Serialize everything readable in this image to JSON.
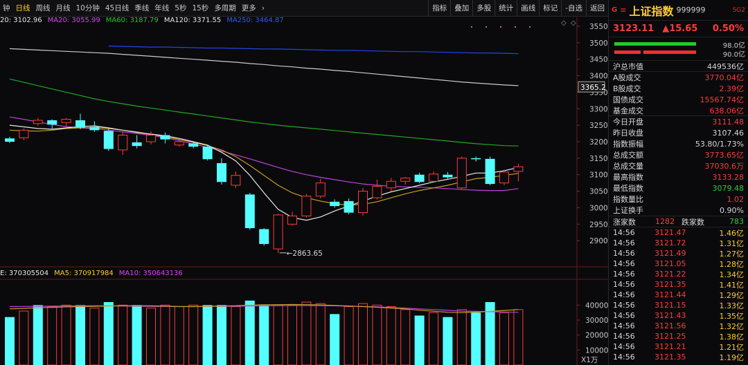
{
  "toolbar": {
    "left_items": [
      "钟",
      "日线",
      "周线",
      "月线",
      "10分钟",
      "45日线",
      "季线",
      "年线",
      "5秒",
      "15秒",
      "多周期",
      "更多"
    ],
    "active_index": 1,
    "more_arrow": "›",
    "right_items": [
      "指标",
      "叠加",
      "多股",
      "统计",
      "画线",
      "标记",
      "-自选",
      "返回"
    ]
  },
  "ma_legend": [
    {
      "label": "20: 3102.96",
      "color": "#e8e8e8"
    },
    {
      "label": "MA20: 3055.99",
      "color": "#e040fb"
    },
    {
      "label": "MA60: 3187.79",
      "color": "#22cc22"
    },
    {
      "label": "MA120: 3371.55",
      "color": "#e8e8e8"
    },
    {
      "label": "MA250: 3464.87",
      "color": "#3355ff"
    }
  ],
  "vol_legend": [
    {
      "label": "E: 370305504",
      "color": "#e8e8e8"
    },
    {
      "label": "MA5: 370917984",
      "color": "#ffcc33"
    },
    {
      "label": "MA10: 350643136",
      "color": "#e040fb"
    }
  ],
  "chart_data": {
    "type": "candlestick",
    "price_axis": {
      "min": 2850,
      "max": 3550,
      "ticks": [
        3550,
        3500,
        3450,
        3400,
        3350,
        3300,
        3250,
        3200,
        3150,
        3100,
        3050,
        3000,
        2950,
        2900
      ]
    },
    "price_marker": "3365.2",
    "low_annotation": "2863.65",
    "volume_axis": {
      "max": 48000,
      "ticks": [
        40000,
        30000,
        20000,
        10000
      ],
      "unit_label": "X1万"
    },
    "candles": [
      {
        "o": 3210,
        "c": 3200,
        "h": 3215,
        "l": 3196
      },
      {
        "o": 3212,
        "c": 3235,
        "h": 3240,
        "l": 3205
      },
      {
        "o": 3255,
        "c": 3265,
        "h": 3272,
        "l": 3248
      },
      {
        "o": 3265,
        "c": 3252,
        "h": 3268,
        "l": 3240
      },
      {
        "o": 3258,
        "c": 3268,
        "h": 3272,
        "l": 3245
      },
      {
        "o": 3265,
        "c": 3243,
        "h": 3285,
        "l": 3238
      },
      {
        "o": 3245,
        "c": 3235,
        "h": 3262,
        "l": 3230
      },
      {
        "o": 3233,
        "c": 3178,
        "h": 3240,
        "l": 3172
      },
      {
        "o": 3175,
        "c": 3220,
        "h": 3230,
        "l": 3160
      },
      {
        "o": 3198,
        "c": 3187,
        "h": 3220,
        "l": 3180
      },
      {
        "o": 3200,
        "c": 3220,
        "h": 3232,
        "l": 3192
      },
      {
        "o": 3220,
        "c": 3207,
        "h": 3228,
        "l": 3195
      },
      {
        "o": 3190,
        "c": 3200,
        "h": 3205,
        "l": 3185
      },
      {
        "o": 3195,
        "c": 3185,
        "h": 3200,
        "l": 3180
      },
      {
        "o": 3185,
        "c": 3147,
        "h": 3190,
        "l": 3143
      },
      {
        "o": 3135,
        "c": 3078,
        "h": 3150,
        "l": 3070
      },
      {
        "o": 3068,
        "c": 3098,
        "h": 3110,
        "l": 3060
      },
      {
        "o": 3040,
        "c": 2938,
        "h": 3045,
        "l": 2933
      },
      {
        "o": 2935,
        "c": 2890,
        "h": 2938,
        "l": 2885
      },
      {
        "o": 2875,
        "c": 2978,
        "h": 2982,
        "l": 2863
      },
      {
        "o": 2950,
        "c": 2975,
        "h": 2988,
        "l": 2945
      },
      {
        "o": 2975,
        "c": 3035,
        "h": 3042,
        "l": 2970
      },
      {
        "o": 3035,
        "c": 3075,
        "h": 3088,
        "l": 3028
      },
      {
        "o": 3018,
        "c": 3005,
        "h": 3025,
        "l": 3000
      },
      {
        "o": 3020,
        "c": 2985,
        "h": 3028,
        "l": 2980
      },
      {
        "o": 2985,
        "c": 3050,
        "h": 3060,
        "l": 2975
      },
      {
        "o": 3030,
        "c": 3065,
        "h": 3085,
        "l": 3025
      },
      {
        "o": 3060,
        "c": 3080,
        "h": 3090,
        "l": 3050
      },
      {
        "o": 3080,
        "c": 3090,
        "h": 3093,
        "l": 3070
      },
      {
        "o": 3100,
        "c": 3078,
        "h": 3106,
        "l": 3074
      },
      {
        "o": 3080,
        "c": 3102,
        "h": 3110,
        "l": 3078
      },
      {
        "o": 3100,
        "c": 3092,
        "h": 3108,
        "l": 3088
      },
      {
        "o": 3060,
        "c": 3150,
        "h": 3155,
        "l": 3055
      },
      {
        "o": 3150,
        "c": 3148,
        "h": 3155,
        "l": 3140
      },
      {
        "o": 3148,
        "c": 3072,
        "h": 3155,
        "l": 3068
      },
      {
        "o": 3075,
        "c": 3108,
        "h": 3115,
        "l": 3068
      },
      {
        "o": 3110,
        "c": 3124,
        "h": 3133,
        "l": 3080
      }
    ],
    "volumes": [
      {
        "v": 32000,
        "dir": "down"
      },
      {
        "v": 36000,
        "dir": "up"
      },
      {
        "v": 40000,
        "dir": "down"
      },
      {
        "v": 39000,
        "dir": "up"
      },
      {
        "v": 40000,
        "dir": "up"
      },
      {
        "v": 40000,
        "dir": "down"
      },
      {
        "v": 38000,
        "dir": "up"
      },
      {
        "v": 42000,
        "dir": "down"
      },
      {
        "v": 40000,
        "dir": "up"
      },
      {
        "v": 40000,
        "dir": "down"
      },
      {
        "v": 38000,
        "dir": "up"
      },
      {
        "v": 40000,
        "dir": "up"
      },
      {
        "v": 39000,
        "dir": "up"
      },
      {
        "v": 40000,
        "dir": "up"
      },
      {
        "v": 40000,
        "dir": "down"
      },
      {
        "v": 40000,
        "dir": "down"
      },
      {
        "v": 39000,
        "dir": "up"
      },
      {
        "v": 43000,
        "dir": "down"
      },
      {
        "v": 40000,
        "dir": "down"
      },
      {
        "v": 40000,
        "dir": "up"
      },
      {
        "v": 40000,
        "dir": "up"
      },
      {
        "v": 42000,
        "dir": "up"
      },
      {
        "v": 41000,
        "dir": "up"
      },
      {
        "v": 34000,
        "dir": "down"
      },
      {
        "v": 39000,
        "dir": "up"
      },
      {
        "v": 41000,
        "dir": "up"
      },
      {
        "v": 40000,
        "dir": "up"
      },
      {
        "v": 39000,
        "dir": "up"
      },
      {
        "v": 37000,
        "dir": "up"
      },
      {
        "v": 33000,
        "dir": "down"
      },
      {
        "v": 35000,
        "dir": "up"
      },
      {
        "v": 32000,
        "dir": "down"
      },
      {
        "v": 37000,
        "dir": "up"
      },
      {
        "v": 35000,
        "dir": "down"
      },
      {
        "v": 42000,
        "dir": "down"
      },
      {
        "v": 35000,
        "dir": "up"
      },
      {
        "v": 37000,
        "dir": "up"
      }
    ],
    "lines": {
      "ma10": {
        "color": "#e8e8e8",
        "values": [
          3250,
          3245,
          3240,
          3238,
          3242,
          3246,
          3248,
          3242,
          3235,
          3228,
          3223,
          3218,
          3210,
          3200,
          3190,
          3168,
          3142,
          3098,
          3045,
          2995,
          2970,
          2962,
          2972,
          2990,
          3005,
          3020,
          3035,
          3048,
          3058,
          3068,
          3078,
          3086,
          3095,
          3105,
          3105,
          3112,
          3122
        ]
      },
      "ma20": {
        "color": "#c8a020",
        "values": [
          3235,
          3233,
          3232,
          3235,
          3240,
          3242,
          3243,
          3240,
          3235,
          3230,
          3222,
          3215,
          3207,
          3198,
          3188,
          3175,
          3155,
          3128,
          3098,
          3068,
          3045,
          3030,
          3020,
          3012,
          3008,
          3010,
          3018,
          3030,
          3042,
          3052,
          3060,
          3068,
          3078,
          3088,
          3092,
          3098,
          3104
        ]
      },
      "ma30": {
        "color": "#c040e0",
        "values": [
          3275,
          3268,
          3260,
          3252,
          3246,
          3242,
          3240,
          3235,
          3230,
          3225,
          3220,
          3212,
          3203,
          3193,
          3183,
          3172,
          3160,
          3148,
          3135,
          3122,
          3110,
          3100,
          3092,
          3085,
          3078,
          3072,
          3068,
          3065,
          3063,
          3062,
          3060,
          3058,
          3055,
          3053,
          3052,
          3052,
          3058
        ]
      },
      "ma60": {
        "color": "#22aa22",
        "values": [
          3390,
          3380,
          3370,
          3360,
          3350,
          3340,
          3330,
          3322,
          3315,
          3308,
          3302,
          3296,
          3290,
          3284,
          3278,
          3272,
          3266,
          3260,
          3255,
          3250,
          3246,
          3242,
          3238,
          3234,
          3230,
          3226,
          3222,
          3218,
          3214,
          3210,
          3206,
          3202,
          3198,
          3194,
          3191,
          3188,
          3187
        ]
      },
      "ma120": {
        "color": "#cccccc",
        "values": [
          3482,
          3480,
          3478,
          3476,
          3474,
          3472,
          3470,
          3468,
          3465,
          3462,
          3459,
          3456,
          3453,
          3450,
          3447,
          3444,
          3441,
          3437,
          3434,
          3430,
          3427,
          3423,
          3420,
          3416,
          3413,
          3409,
          3405,
          3401,
          3397,
          3393,
          3389,
          3385,
          3381,
          3378,
          3375,
          3372,
          3370
        ]
      },
      "ma250": {
        "color": "#2244ee",
        "start_index": 7,
        "values": [
          3490,
          3489,
          3488,
          3487,
          3487,
          3486,
          3485,
          3484,
          3484,
          3483,
          3482,
          3481,
          3481,
          3480,
          3479,
          3478,
          3477,
          3477,
          3476,
          3475,
          3474,
          3473,
          3473,
          3472,
          3471,
          3470,
          3469,
          3469,
          3468,
          3467
        ]
      }
    },
    "vol_lines": {
      "vma5": {
        "color": "#c8a020",
        "values": [
          37500,
          37800,
          38200,
          38500,
          38800,
          39000,
          39200,
          39400,
          39500,
          39600,
          39500,
          39300,
          39100,
          39000,
          39200,
          39400,
          39600,
          40000,
          40200,
          40300,
          40400,
          40300,
          40100,
          39800,
          39400,
          39000,
          38600,
          38000,
          37500,
          36600,
          35900,
          35200,
          35000,
          35300,
          35800,
          36400,
          37000
        ]
      },
      "vma10": {
        "color": "#c040e0",
        "values": [
          39000,
          39100,
          39200,
          39300,
          39400,
          39500,
          39500,
          39500,
          39400,
          39300,
          39200,
          39100,
          39000,
          39000,
          39100,
          39200,
          39300,
          39400,
          39500,
          39600,
          39700,
          39700,
          39600,
          39500,
          39300,
          39100,
          38800,
          38400,
          38000,
          37500,
          37000,
          36500,
          36000,
          35800,
          35600,
          35400,
          35200
        ]
      }
    }
  },
  "panel": {
    "g_label": "G",
    "eq_label": "≡",
    "name": "上证指数",
    "code": "999999",
    "badge": "SG2",
    "price": "3123.11",
    "change": "▲15.65",
    "pct": "0.50%",
    "bar_labels": [
      "98.0亿",
      "90.0亿"
    ],
    "rows": [
      {
        "label": "沪总市值",
        "value": "449536亿",
        "cls": "white",
        "sep": true
      },
      {
        "label": "A股成交",
        "value": "3770.04亿",
        "cls": "red"
      },
      {
        "label": "B股成交",
        "value": "2.39亿",
        "cls": "red"
      },
      {
        "label": "国债成交",
        "value": "15567.74亿",
        "cls": "red"
      },
      {
        "label": "基金成交",
        "value": "638.06亿",
        "cls": "red",
        "sep": true
      },
      {
        "label": "今日开盘",
        "value": "3111.48",
        "cls": "red"
      },
      {
        "label": "昨日收盘",
        "value": "3107.46",
        "cls": "white"
      },
      {
        "label": "指数振幅",
        "value": "53.80/1.73%",
        "cls": "white"
      },
      {
        "label": "总成交额",
        "value": "3773.65亿",
        "cls": "red"
      },
      {
        "label": "总成交量",
        "value": "37030.6万",
        "cls": "red"
      },
      {
        "label": "最高指数",
        "value": "3133.28",
        "cls": "red"
      },
      {
        "label": "最低指数",
        "value": "3079.48",
        "cls": "green"
      },
      {
        "label": "指数量比",
        "value": "1.02",
        "cls": "red"
      },
      {
        "label": "上证换手",
        "value": "0.90%",
        "cls": "white"
      }
    ],
    "up_label": "涨家数",
    "up_value": "1282",
    "down_label": "跌家数",
    "down_value": "783",
    "ticks": [
      {
        "t": "14:56",
        "p": "3121.47",
        "v": "1.46亿"
      },
      {
        "t": "14:56",
        "p": "3121.72",
        "v": "1.31亿"
      },
      {
        "t": "14:56",
        "p": "3121.49",
        "v": "1.27亿"
      },
      {
        "t": "14:56",
        "p": "3121.05",
        "v": "1.28亿"
      },
      {
        "t": "14:56",
        "p": "3121.22",
        "v": "1.34亿"
      },
      {
        "t": "14:56",
        "p": "3121.35",
        "v": "1.41亿"
      },
      {
        "t": "14:56",
        "p": "3121.44",
        "v": "1.29亿"
      },
      {
        "t": "14:56",
        "p": "3121.15",
        "v": "1.33亿"
      },
      {
        "t": "14:56",
        "p": "3121.43",
        "v": "1.35亿"
      },
      {
        "t": "14:56",
        "p": "3121.56",
        "v": "1.32亿"
      },
      {
        "t": "14:56",
        "p": "3121.25",
        "v": "1.38亿"
      },
      {
        "t": "14:56",
        "p": "3121.21",
        "v": "1.21亿"
      },
      {
        "t": "14:56",
        "p": "3121.35",
        "v": "1.19亿"
      }
    ]
  }
}
